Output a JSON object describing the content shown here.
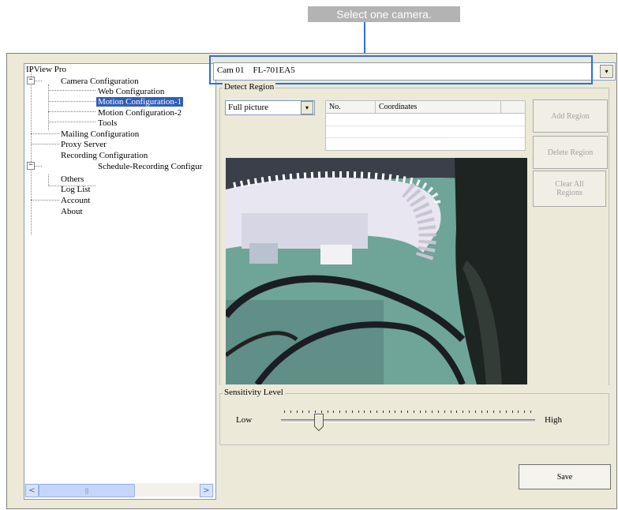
{
  "callout": {
    "text": "Select one camera."
  },
  "tree": {
    "root": "IPView Pro",
    "camera_configuration": "Camera Configuration",
    "web_configuration": "Web Configuration",
    "motion_configuration_1": "Motion Configuration-1",
    "motion_configuration_2": "Motion Configuration-2",
    "tools": "Tools",
    "mailing_configuration": "Mailing Configuration",
    "proxy_server": "Proxy Server",
    "recording_configuration": "Recording Configuration",
    "schedule_recording": "Schedule-Recording Configur",
    "others": "Others",
    "log_list": "Log List",
    "account": "Account",
    "about": "About",
    "collapse_glyph": "−",
    "scroll_left": "<",
    "scroll_right": ">",
    "scroll_thumb": "|||"
  },
  "camera_select": {
    "value": "Cam 01    FL-701EA5",
    "arrow": "▾"
  },
  "detect_region": {
    "label": "Detect Region",
    "mode_value": "Full picture",
    "mode_arrow": "▾",
    "columns": [
      "No.",
      "Coordinates",
      ""
    ]
  },
  "buttons": {
    "add_region": "Add Region",
    "delete_region": "Delete Region",
    "clear_all_regions": "Clear All Regions",
    "save": "Save"
  },
  "sensitivity": {
    "label": "Sensitivity Level",
    "low": "Low",
    "high": "High",
    "level_fraction": 0.14
  },
  "colors": {
    "selection": "#2e5eb8",
    "highlight": "#2f6fd6",
    "window": "#ece9d8"
  }
}
